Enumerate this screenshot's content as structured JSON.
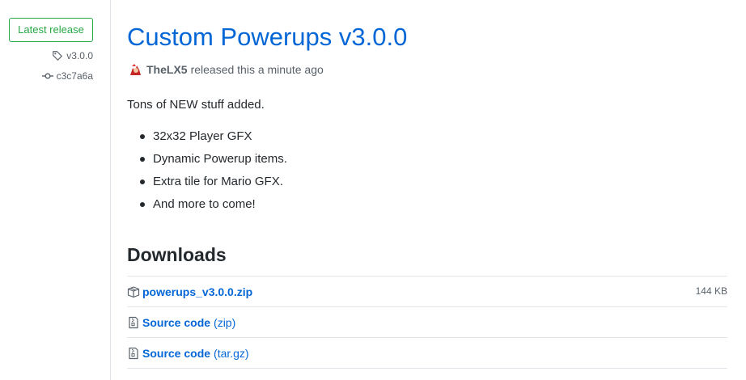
{
  "sidebar": {
    "release_label": "Latest release",
    "tag": "v3.0.0",
    "commit": "c3c7a6a"
  },
  "release": {
    "title": "Custom Powerups v3.0.0",
    "author": "TheLX5",
    "released_text": "released this a minute ago",
    "description": "Tons of NEW stuff added.",
    "features": [
      "32x32 Player GFX",
      "Dynamic Powerup items.",
      "Extra tile for Mario GFX.",
      "And more to come!"
    ]
  },
  "downloads": {
    "heading": "Downloads",
    "assets": [
      {
        "name": "powerups_v3.0.0.zip",
        "size": "144 KB",
        "icon": "package-icon"
      },
      {
        "name": "Source code",
        "format": "(zip)",
        "icon": "file-zip-icon"
      },
      {
        "name": "Source code",
        "format": "(tar.gz)",
        "icon": "file-zip-icon"
      }
    ]
  },
  "colors": {
    "link": "#0366d6",
    "green": "#28a745",
    "muted": "#586069",
    "border": "#e1e4e8"
  }
}
